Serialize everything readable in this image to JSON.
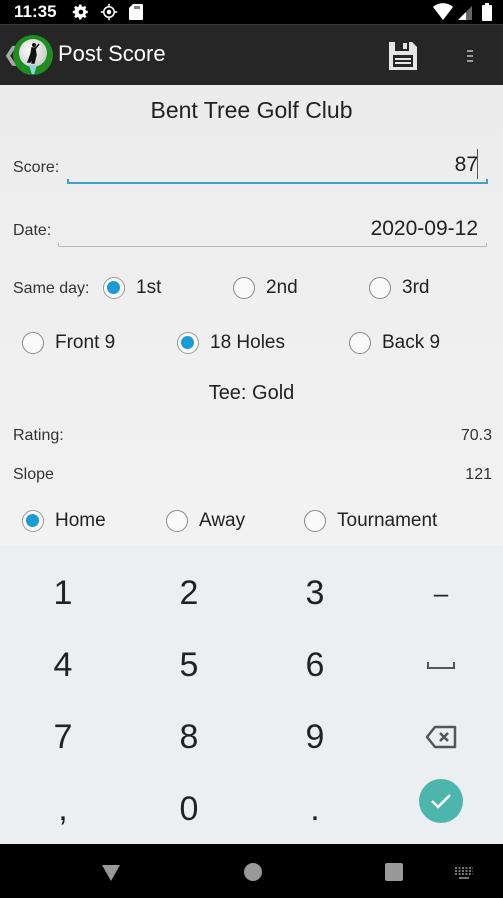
{
  "status_bar": {
    "time": "11:35",
    "icons": [
      "gear-icon",
      "location-icon",
      "sd-card-icon",
      "wifi-icon",
      "signal-icon",
      "battery-icon"
    ]
  },
  "app_bar": {
    "title": "Post Score",
    "back_icon": "chevron-left-icon",
    "logo": "golf-ball-logo",
    "actions": [
      "save-icon",
      "overflow-menu-icon"
    ]
  },
  "form": {
    "club_name": "Bent Tree Golf Club",
    "score_label": "Score:",
    "score_value": "87",
    "date_label": "Date:",
    "date_value": "2020-09-12",
    "same_day_label": "Same day:",
    "same_day_options": [
      {
        "label": "1st",
        "checked": true
      },
      {
        "label": "2nd",
        "checked": false
      },
      {
        "label": "3rd",
        "checked": false
      }
    ],
    "holes_options": [
      {
        "label": "Front 9",
        "checked": false
      },
      {
        "label": "18 Holes",
        "checked": true
      },
      {
        "label": "Back 9",
        "checked": false
      }
    ],
    "tee": "Tee: Gold",
    "rating_label": "Rating:",
    "rating_value": "70.3",
    "slope_label": "Slope",
    "slope_value": "121",
    "type_options": [
      {
        "label": "Home",
        "checked": true
      },
      {
        "label": "Away",
        "checked": false
      },
      {
        "label": "Tournament",
        "checked": false
      }
    ],
    "accent_color": "#1a9ad6"
  },
  "keyboard": {
    "keys": [
      "1",
      "2",
      "3",
      "–",
      "4",
      "5",
      "6",
      "space",
      "7",
      "8",
      "9",
      "backspace",
      ",",
      "0",
      ".",
      "done"
    ],
    "done_color": "#4db6ac"
  },
  "nav_bar": {
    "buttons": [
      "back-icon",
      "home-icon",
      "recents-icon",
      "keyboard-switch-icon"
    ]
  }
}
